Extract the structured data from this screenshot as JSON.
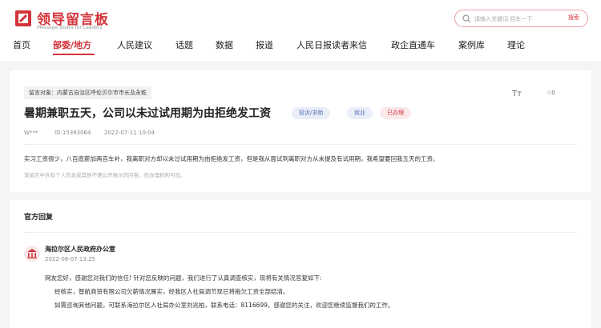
{
  "header": {
    "logo_title": "领导留言板",
    "logo_subtitle": "Message Board for Leaders",
    "search_placeholder": "请输入关键词 回车一下",
    "search_button": "搜索"
  },
  "nav": {
    "items": [
      "首页",
      "部委/地方",
      "人民建议",
      "话题",
      "数据",
      "报道",
      "人民日报读者来信",
      "政企直通车",
      "案例库",
      "理论"
    ],
    "active_index": 1
  },
  "message": {
    "target_label": "留言对象：内蒙古自治区呼伦贝尔市市长及永乾",
    "title": "暑期兼职五天，公司以未过试用期为由拒绝发工资",
    "tags": {
      "type": "投诉/求助",
      "field": "就业",
      "status": "已办理"
    },
    "font_icon": "Tт",
    "fav_count": "☆0",
    "author": "W***",
    "id": "ID:15393064",
    "date": "2022-07-11 10:04",
    "content": "实习工资很少，八百底薪加两百车补，我离职对方却以未过试用期为由拒绝发工资，但是我从面试到离职对方从未提及有试用期，我希望要回我五天的工资。",
    "notice": "该留言中含有个人信息或其他不便公开展示的内容，仅办理机构可见。"
  },
  "reply": {
    "heading": "官方回复",
    "org_name": "海拉尔区人民政府办公室",
    "date": "2022-08-07 13:25",
    "lines": [
      "网友您好，感谢您对我们的信任! 针对您反映的问题，我们进行了认真调查核实，现将有关情况答复如下:",
      "经核实，智航商贸有限公司欠薪情况属实，经我区人社局调节现已将拖欠工资全部结清。",
      "如需咨询其他问题，可联系海拉尔区人社局办公室刘兆柏，联系电话：8116699。感谢您的关注，欢迎您继续监督我们的工作。"
    ]
  },
  "colors": {
    "brand": "#d4343b",
    "tag_blue": "#5673b6"
  }
}
